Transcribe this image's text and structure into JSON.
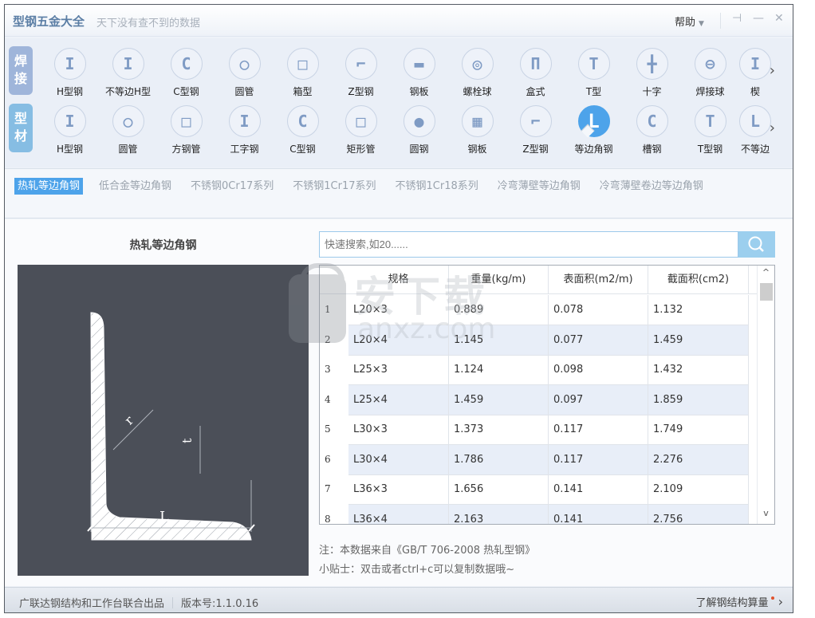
{
  "titlebar": {
    "title": "型钢五金大全",
    "slogan": "天下没有查不到的数据",
    "help_label": "帮助",
    "help_caret": "▼",
    "pin_icon": "⊣",
    "minimize_icon": "—",
    "close_icon": "✕"
  },
  "categories": {
    "weld_label_1": "焊",
    "weld_label_2": "接",
    "profile_label_1": "型",
    "profile_label_2": "材",
    "weld_items": [
      {
        "label": "H型钢",
        "glyph": "I"
      },
      {
        "label": "不等边H型",
        "glyph": "I"
      },
      {
        "label": "C型钢",
        "glyph": "C"
      },
      {
        "label": "圆管",
        "glyph": "○"
      },
      {
        "label": "箱型",
        "glyph": "□"
      },
      {
        "label": "Z型钢",
        "glyph": "⌐"
      },
      {
        "label": "钢板",
        "glyph": "▬"
      },
      {
        "label": "螺栓球",
        "glyph": "◎"
      },
      {
        "label": "盒式",
        "glyph": "Π"
      },
      {
        "label": "T型",
        "glyph": "T"
      },
      {
        "label": "十字",
        "glyph": "╋"
      },
      {
        "label": "焊接球",
        "glyph": "⊖"
      },
      {
        "label": "楔",
        "glyph": "I"
      }
    ],
    "profile_items": [
      {
        "label": "H型钢",
        "glyph": "I"
      },
      {
        "label": "圆管",
        "glyph": "○"
      },
      {
        "label": "方钢管",
        "glyph": "□"
      },
      {
        "label": "工字钢",
        "glyph": "I"
      },
      {
        "label": "C型钢",
        "glyph": "C"
      },
      {
        "label": "矩形管",
        "glyph": "□"
      },
      {
        "label": "圆钢",
        "glyph": "●"
      },
      {
        "label": "钢板",
        "glyph": "▦"
      },
      {
        "label": "Z型钢",
        "glyph": "⌐"
      },
      {
        "label": "等边角钢",
        "glyph": "L",
        "selected": true
      },
      {
        "label": "槽钢",
        "glyph": "C"
      },
      {
        "label": "T型钢",
        "glyph": "T"
      },
      {
        "label": "不等边",
        "glyph": "L"
      }
    ],
    "next_arrow": "›"
  },
  "subtabs": [
    {
      "label": "热轧等边角钢",
      "active": true
    },
    {
      "label": "低合金等边角钢"
    },
    {
      "label": "不锈钢0Cr17系列"
    },
    {
      "label": "不锈钢1Cr17系列"
    },
    {
      "label": "不锈钢1Cr18系列"
    },
    {
      "label": "冷弯薄壁等边角钢"
    },
    {
      "label": "冷弯薄壁卷边等边角钢"
    }
  ],
  "main": {
    "section_title": "热轧等边角钢",
    "diagram_labels": {
      "r": "r",
      "t": "t",
      "L": "L"
    },
    "search": {
      "placeholder": "快速搜索,如20......",
      "value": ""
    },
    "table": {
      "columns": [
        "规格",
        "重量(kg/m)",
        "表面积(m2/m)",
        "截面积(cm2)"
      ],
      "rows": [
        {
          "index": "1",
          "spec": "L20×3",
          "weight": "0.889",
          "surface": "0.078",
          "section": "1.132"
        },
        {
          "index": "2",
          "spec": "L20×4",
          "weight": "1.145",
          "surface": "0.077",
          "section": "1.459"
        },
        {
          "index": "3",
          "spec": "L25×3",
          "weight": "1.124",
          "surface": "0.098",
          "section": "1.432"
        },
        {
          "index": "4",
          "spec": "L25×4",
          "weight": "1.459",
          "surface": "0.097",
          "section": "1.859"
        },
        {
          "index": "5",
          "spec": "L30×3",
          "weight": "1.373",
          "surface": "0.117",
          "section": "1.749"
        },
        {
          "index": "6",
          "spec": "L30×4",
          "weight": "1.786",
          "surface": "0.117",
          "section": "2.276"
        },
        {
          "index": "7",
          "spec": "L36×3",
          "weight": "1.656",
          "surface": "0.141",
          "section": "2.109"
        },
        {
          "index": "8",
          "spec": "L36×4",
          "weight": "2.163",
          "surface": "0.141",
          "section": "2.756"
        }
      ],
      "scroll_up": "^",
      "scroll_down": "v"
    },
    "note_source": "注：本数据来自《GB/T  706-2008  热轧型钢》",
    "note_tip": "小贴士：双击或者ctrl+c可以复制数据哦~"
  },
  "footer": {
    "producer": "广联达钢结构和工作台联合出品",
    "version": "版本号:1.1.0.16",
    "link": "了解钢结构算量",
    "link_arrow": "›"
  },
  "watermark": {
    "text": "安下载",
    "url": "anxz.com"
  }
}
